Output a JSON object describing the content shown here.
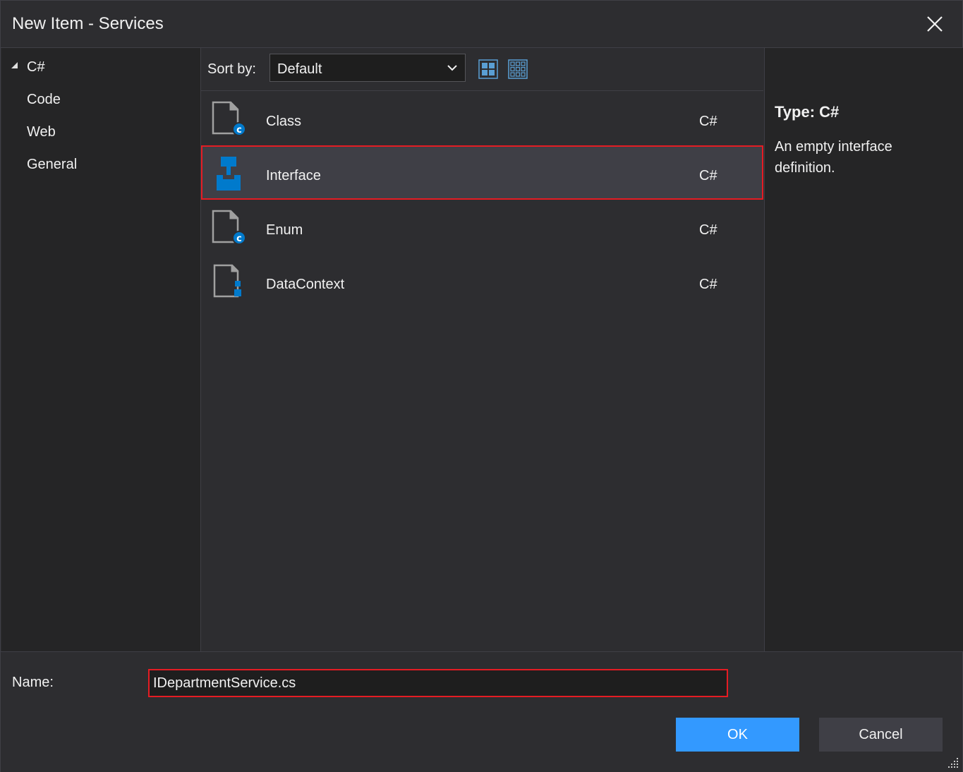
{
  "window": {
    "title": "New Item - Services"
  },
  "tree": {
    "items": [
      {
        "label": "C#",
        "expanded": true
      },
      {
        "label": "Code"
      },
      {
        "label": "Web"
      },
      {
        "label": "General"
      }
    ]
  },
  "toolbar": {
    "sort_label": "Sort by:",
    "sort_value": "Default",
    "view_options": [
      "medium-icons-view-icon",
      "small-icons-view-icon"
    ]
  },
  "templates": [
    {
      "name": "Class",
      "language": "C#",
      "icon": "class-file-icon",
      "selected": false
    },
    {
      "name": "Interface",
      "language": "C#",
      "icon": "interface-icon",
      "selected": true
    },
    {
      "name": "Enum",
      "language": "C#",
      "icon": "enum-file-icon",
      "selected": false
    },
    {
      "name": "DataContext",
      "language": "C#",
      "icon": "datacontext-file-icon",
      "selected": false
    }
  ],
  "detail": {
    "type": "Type: C#",
    "description": "An empty interface definition."
  },
  "form": {
    "name_label": "Name:",
    "name_value": "IDepartmentService.cs"
  },
  "buttons": {
    "ok": "OK",
    "cancel": "Cancel"
  },
  "colors": {
    "background": "#2d2d30",
    "pane": "#252526",
    "accent": "#3399ff",
    "icon_blue": "#007acc",
    "highlight_border": "#e51c23"
  }
}
